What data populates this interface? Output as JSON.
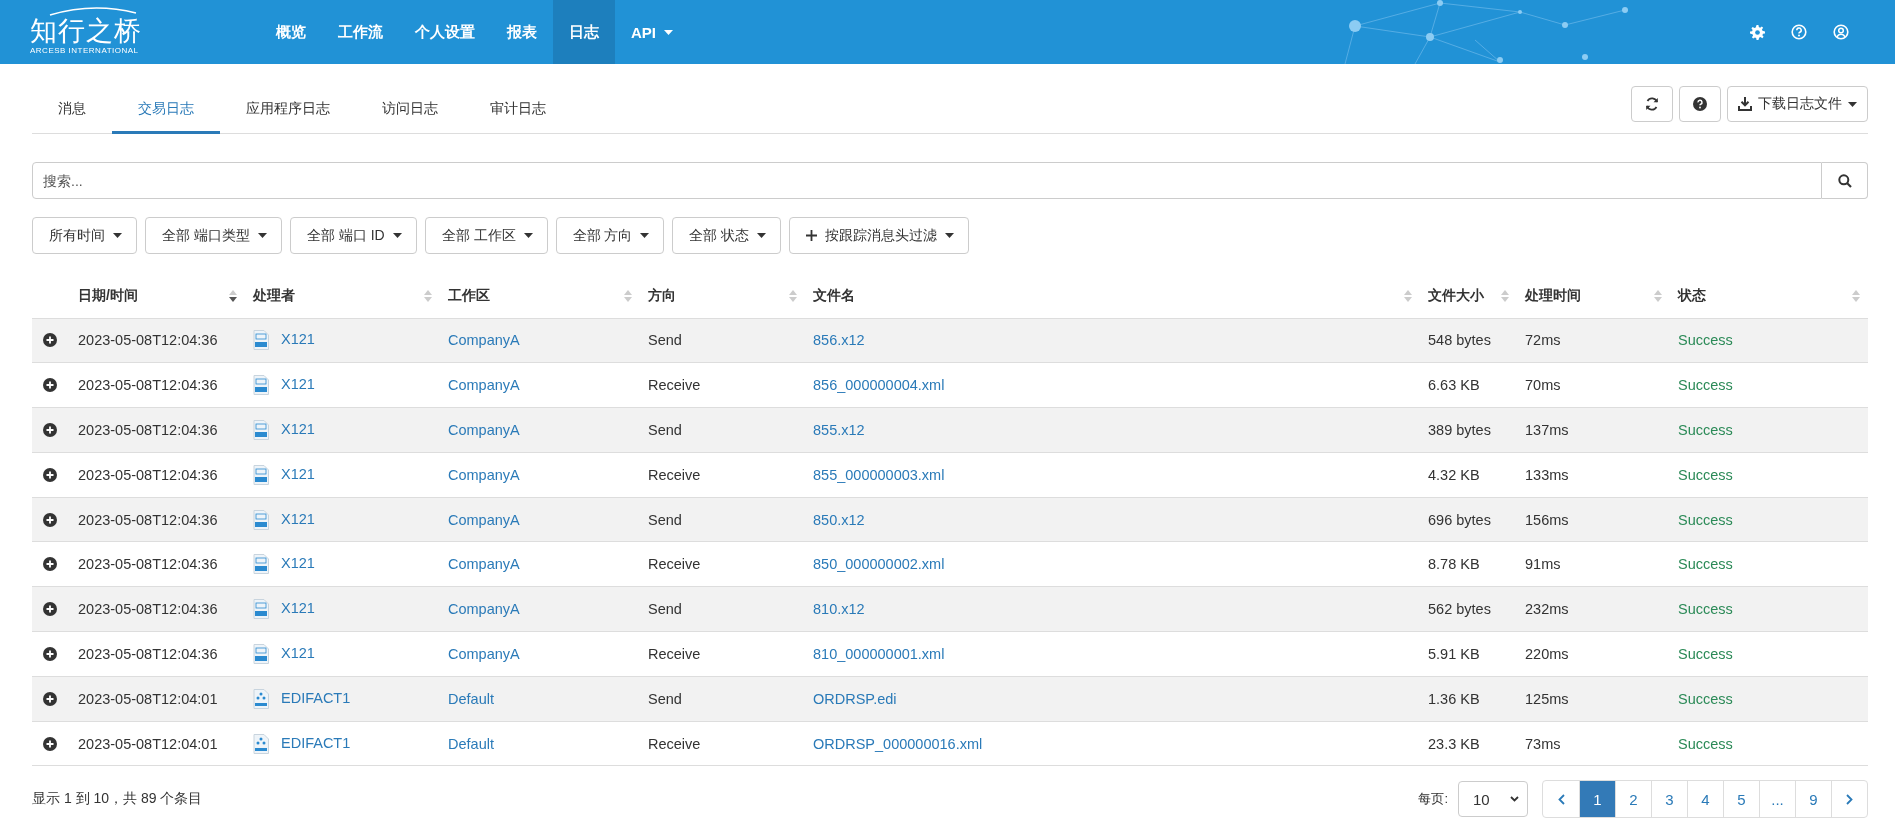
{
  "logo": {
    "title": "知行之桥",
    "subtitle": "ARCESB INTERNATIONAL"
  },
  "nav": [
    {
      "label": "概览",
      "selected": false,
      "dropdown": false
    },
    {
      "label": "工作流",
      "selected": false,
      "dropdown": false
    },
    {
      "label": "个人设置",
      "selected": false,
      "dropdown": false
    },
    {
      "label": "报表",
      "selected": false,
      "dropdown": false
    },
    {
      "label": "日志",
      "selected": true,
      "dropdown": false
    },
    {
      "label": "API",
      "selected": false,
      "dropdown": true
    }
  ],
  "tabs": [
    {
      "label": "消息",
      "selected": false
    },
    {
      "label": "交易日志",
      "selected": true
    },
    {
      "label": "应用程序日志",
      "selected": false
    },
    {
      "label": "访问日志",
      "selected": false
    },
    {
      "label": "审计日志",
      "selected": false
    }
  ],
  "download_button": "下载日志文件",
  "search": {
    "placeholder": "搜索..."
  },
  "filters": [
    {
      "label": "所有时间",
      "kind": "select"
    },
    {
      "label": "全部 端口类型",
      "kind": "select"
    },
    {
      "label": "全部 端口 ID",
      "kind": "select"
    },
    {
      "label": "全部 工作区",
      "kind": "select"
    },
    {
      "label": "全部 方向",
      "kind": "select"
    },
    {
      "label": "全部 状态",
      "kind": "select"
    },
    {
      "label": "按跟踪消息头过滤",
      "kind": "add"
    }
  ],
  "table": {
    "columns": [
      {
        "label": "日期/时间",
        "sorted": true
      },
      {
        "label": "处理者",
        "sorted": false
      },
      {
        "label": "工作区",
        "sorted": false
      },
      {
        "label": "方向",
        "sorted": false
      },
      {
        "label": "文件名",
        "sorted": false
      },
      {
        "label": "文件大小",
        "sorted": false
      },
      {
        "label": "处理时间",
        "sorted": false
      },
      {
        "label": "状态",
        "sorted": false
      }
    ],
    "rows": [
      {
        "datetime": "2023-05-08T12:04:36",
        "kind": "x12",
        "handler": "X121",
        "workspace": "CompanyA",
        "direction": "Send",
        "filename": "856.x12",
        "size": "548 bytes",
        "time": "72ms",
        "status": "Success"
      },
      {
        "datetime": "2023-05-08T12:04:36",
        "kind": "x12",
        "handler": "X121",
        "workspace": "CompanyA",
        "direction": "Receive",
        "filename": "856_000000004.xml",
        "size": "6.63 KB",
        "time": "70ms",
        "status": "Success"
      },
      {
        "datetime": "2023-05-08T12:04:36",
        "kind": "x12",
        "handler": "X121",
        "workspace": "CompanyA",
        "direction": "Send",
        "filename": "855.x12",
        "size": "389 bytes",
        "time": "137ms",
        "status": "Success"
      },
      {
        "datetime": "2023-05-08T12:04:36",
        "kind": "x12",
        "handler": "X121",
        "workspace": "CompanyA",
        "direction": "Receive",
        "filename": "855_000000003.xml",
        "size": "4.32 KB",
        "time": "133ms",
        "status": "Success"
      },
      {
        "datetime": "2023-05-08T12:04:36",
        "kind": "x12",
        "handler": "X121",
        "workspace": "CompanyA",
        "direction": "Send",
        "filename": "850.x12",
        "size": "696 bytes",
        "time": "156ms",
        "status": "Success"
      },
      {
        "datetime": "2023-05-08T12:04:36",
        "kind": "x12",
        "handler": "X121",
        "workspace": "CompanyA",
        "direction": "Receive",
        "filename": "850_000000002.xml",
        "size": "8.78 KB",
        "time": "91ms",
        "status": "Success"
      },
      {
        "datetime": "2023-05-08T12:04:36",
        "kind": "x12",
        "handler": "X121",
        "workspace": "CompanyA",
        "direction": "Send",
        "filename": "810.x12",
        "size": "562 bytes",
        "time": "232ms",
        "status": "Success"
      },
      {
        "datetime": "2023-05-08T12:04:36",
        "kind": "x12",
        "handler": "X121",
        "workspace": "CompanyA",
        "direction": "Receive",
        "filename": "810_000000001.xml",
        "size": "5.91 KB",
        "time": "220ms",
        "status": "Success"
      },
      {
        "datetime": "2023-05-08T12:04:01",
        "kind": "edifact",
        "handler": "EDIFACT1",
        "workspace": "Default",
        "direction": "Send",
        "filename": "ORDRSP.edi",
        "size": "1.36 KB",
        "time": "125ms",
        "status": "Success"
      },
      {
        "datetime": "2023-05-08T12:04:01",
        "kind": "edifact",
        "handler": "EDIFACT1",
        "workspace": "Default",
        "direction": "Receive",
        "filename": "ORDRSP_000000016.xml",
        "size": "23.3 KB",
        "time": "73ms",
        "status": "Success"
      }
    ]
  },
  "footer": {
    "summary": "显示 1 到 10，共 89 个条目",
    "per_page_label": "每页:",
    "per_page": "10",
    "pages": [
      {
        "label": "1",
        "selected": true
      },
      {
        "label": "2",
        "selected": false
      },
      {
        "label": "3",
        "selected": false
      },
      {
        "label": "4",
        "selected": false
      },
      {
        "label": "5",
        "selected": false
      },
      {
        "label": "...",
        "selected": false
      },
      {
        "label": "9",
        "selected": false
      }
    ]
  }
}
